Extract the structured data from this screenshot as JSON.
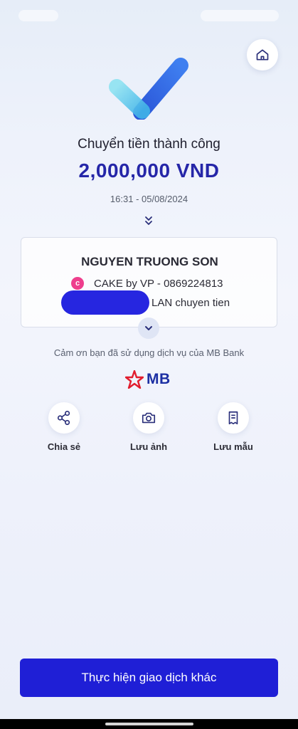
{
  "header": {
    "home_icon": "home-icon"
  },
  "result": {
    "title": "Chuyển tiền thành công",
    "amount": "2,000,000 VND",
    "datetime": "16:31 - 05/08/2024"
  },
  "recipient": {
    "name": "NGUYEN TRUONG SON",
    "bank_account": "CAKE by VP - 0869224813",
    "message": "LAN chuyen tien"
  },
  "footer": {
    "thanks": "Cảm ơn bạn đã sử dụng dịch vụ của MB Bank",
    "brand": "MB"
  },
  "actions": [
    {
      "label": "Chia sẻ",
      "icon": "share-icon"
    },
    {
      "label": "Lưu ảnh",
      "icon": "camera-icon"
    },
    {
      "label": "Lưu mẫu",
      "icon": "receipt-icon"
    }
  ],
  "primary_button": {
    "label": "Thực hiện giao dịch khác"
  },
  "colors": {
    "accent": "#1f1fd6",
    "amount": "#2526a8",
    "brand_red": "#e11d2e"
  }
}
